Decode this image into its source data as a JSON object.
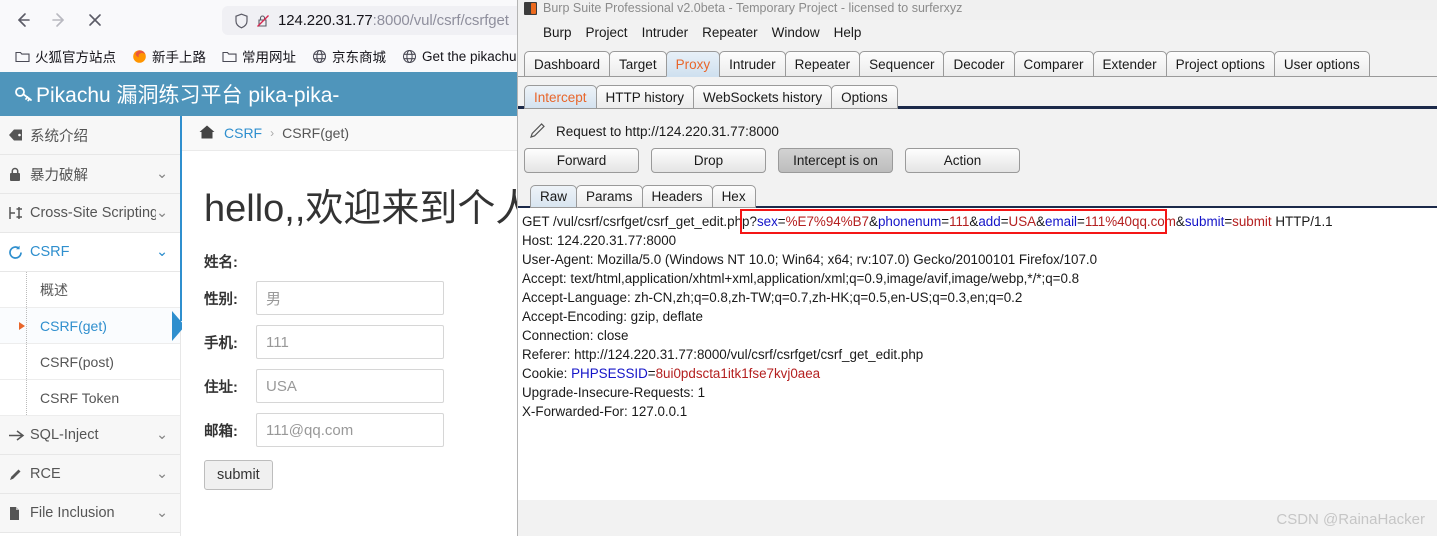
{
  "browser": {
    "nav": {
      "back_label": "Back",
      "forward_label": "Forward",
      "stop_label": "Stop"
    },
    "url": {
      "host": "124.220.31.77",
      "path": ":8000/vul/csrf/csrfget",
      "shield_icon": "shield-icon",
      "permission_icon": "blocked-permission-icon"
    },
    "bookmarks": [
      {
        "label": "火狐官方站点",
        "icon": "folder-icon"
      },
      {
        "label": "新手上路",
        "icon": "firefox-icon"
      },
      {
        "label": "常用网址",
        "icon": "folder-icon"
      },
      {
        "label": "京东商城",
        "icon": "globe-icon"
      },
      {
        "label": "Get the pikachu",
        "icon": "globe-icon"
      }
    ]
  },
  "pikachu": {
    "header_title": "Pikachu 漏洞练习平台 pika-pika-",
    "header_icon": "key-icon",
    "header_bg": "#4f95bb",
    "sidebar": [
      {
        "label": "系统介绍",
        "icon": "tag-icon",
        "chevron": "",
        "active": false
      },
      {
        "label": "暴力破解",
        "icon": "lock-icon",
        "chevron": "⌄",
        "active": false
      },
      {
        "label": "Cross-Site Scripting",
        "icon": "xss-icon",
        "chevron": "⌄",
        "active": false
      },
      {
        "label": "CSRF",
        "icon": "csrf-icon",
        "chevron": "⌄",
        "active": true
      }
    ],
    "sub_items": [
      {
        "label": "概述",
        "selected": false
      },
      {
        "label": "CSRF(get)",
        "selected": true
      },
      {
        "label": "CSRF(post)",
        "selected": false
      },
      {
        "label": "CSRF Token",
        "selected": false
      }
    ],
    "sidebar_tail": [
      {
        "label": "SQL-Inject",
        "icon": "inject-icon",
        "chevron": "⌄"
      },
      {
        "label": "RCE",
        "icon": "pencil-icon",
        "chevron": "⌄"
      },
      {
        "label": "File Inclusion",
        "icon": "file-icon",
        "chevron": "⌄"
      }
    ],
    "breadcrumb": {
      "home_icon": "home-icon",
      "root": "CSRF",
      "separator": "›",
      "current": "CSRF(get)"
    },
    "page_heading": "hello,,欢迎来到个人会",
    "form": {
      "name_label": "姓名:",
      "fields": [
        {
          "label": "性别:",
          "value": "男"
        },
        {
          "label": "手机:",
          "value": "111"
        },
        {
          "label": "住址:",
          "value": "USA"
        },
        {
          "label": "邮箱:",
          "value": "111@qq.com"
        }
      ],
      "submit_label": "submit"
    }
  },
  "burp": {
    "window_title": "Burp Suite Professional v2.0beta - Temporary Project - licensed to surferxyz",
    "menu": [
      "Burp",
      "Project",
      "Intruder",
      "Repeater",
      "Window",
      "Help"
    ],
    "main_tabs": [
      {
        "label": "Dashboard",
        "selected": false
      },
      {
        "label": "Target",
        "selected": false
      },
      {
        "label": "Proxy",
        "selected": true
      },
      {
        "label": "Intruder",
        "selected": false
      },
      {
        "label": "Repeater",
        "selected": false
      },
      {
        "label": "Sequencer",
        "selected": false
      },
      {
        "label": "Decoder",
        "selected": false
      },
      {
        "label": "Comparer",
        "selected": false
      },
      {
        "label": "Extender",
        "selected": false
      },
      {
        "label": "Project options",
        "selected": false
      },
      {
        "label": "User options",
        "selected": false
      }
    ],
    "sub_tabs": [
      {
        "label": "Intercept",
        "selected": true
      },
      {
        "label": "HTTP history",
        "selected": false
      },
      {
        "label": "WebSockets history",
        "selected": false
      },
      {
        "label": "Options",
        "selected": false
      }
    ],
    "request_info": {
      "icon": "pencil-icon",
      "text": "Request to http://124.220.31.77:8000"
    },
    "action_buttons": [
      {
        "label": "Forward",
        "pressed": false
      },
      {
        "label": "Drop",
        "pressed": false
      },
      {
        "label": "Intercept is on",
        "pressed": true
      },
      {
        "label": "Action",
        "pressed": false
      }
    ],
    "view_tabs": [
      {
        "label": "Raw",
        "selected": true
      },
      {
        "label": "Params",
        "selected": false
      },
      {
        "label": "Headers",
        "selected": false
      },
      {
        "label": "Hex",
        "selected": false
      }
    ],
    "request": {
      "method_path": "GET /vul/csrf/csrfget/csrf_get_edit.php",
      "query": [
        {
          "sep": "?",
          "name": "sex",
          "value": "%E7%94%B7"
        },
        {
          "sep": "&",
          "name": "phonenum",
          "value": "111"
        },
        {
          "sep": "&",
          "name": "add",
          "value": "USA"
        },
        {
          "sep": "&",
          "name": "email",
          "value": "111%40qq.com"
        },
        {
          "sep": "&",
          "name": "submit",
          "value": "submit"
        }
      ],
      "protocol": " HTTP/1.1",
      "headers": [
        "Host: 124.220.31.77:8000",
        "User-Agent: Mozilla/5.0 (Windows NT 10.0; Win64; x64; rv:107.0) Gecko/20100101 Firefox/107.0",
        "Accept: text/html,application/xhtml+xml,application/xml;q=0.9,image/avif,image/webp,*/*;q=0.8",
        "Accept-Language: zh-CN,zh;q=0.8,zh-TW;q=0.7,zh-HK;q=0.5,en-US;q=0.3,en;q=0.2",
        "Accept-Encoding: gzip, deflate",
        "Connection: close",
        "Referer: http://124.220.31.77:8000/vul/csrf/csrfget/csrf_get_edit.php"
      ],
      "cookie": {
        "prefix": "Cookie: ",
        "name": "PHPSESSID",
        "value": "8ui0pdscta1itk1fse7kvj0aea"
      },
      "headers_after": [
        "Upgrade-Insecure-Requests: 1",
        "X-Forwarded-For: 127.0.0.1"
      ]
    },
    "highlight_color": "#f41616"
  },
  "watermark": "CSDN @RainaHacker"
}
